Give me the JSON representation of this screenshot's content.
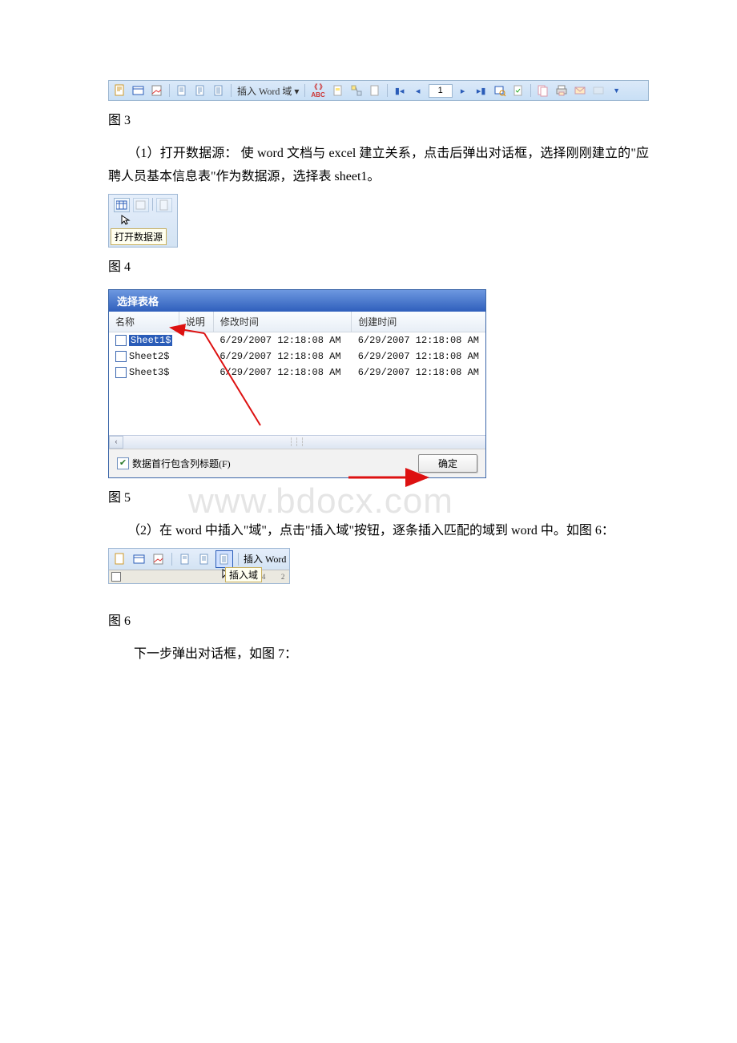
{
  "fig3": {
    "caption": "图 3",
    "insert_word_field": "插入 Word 域 ▾",
    "record_num": "1"
  },
  "paragraph1": "　　（1）打开数据源： 使 word 文档与 excel 建立关系，点击后弹出对话框，选择刚刚建立的\"应聘人员基本信息表\"作为数据源，选择表 sheet1。",
  "fig4": {
    "tooltip": "打开数据源",
    "caption": "图 4"
  },
  "fig5": {
    "title": "选择表格",
    "columns": {
      "name": "名称",
      "desc": "说明",
      "modified": "修改时间",
      "created": "创建时间"
    },
    "rows": [
      {
        "name": "Sheet1$",
        "modified": "6/29/2007 12:18:08 AM",
        "created": "6/29/2007 12:18:08 AM"
      },
      {
        "name": "Sheet2$",
        "modified": "6/29/2007 12:18:08 AM",
        "created": "6/29/2007 12:18:08 AM"
      },
      {
        "name": "Sheet3$",
        "modified": "6/29/2007 12:18:08 AM",
        "created": "6/29/2007 12:18:08 AM"
      }
    ],
    "checkbox": "数据首行包含列标题(F)",
    "ok": "确定",
    "caption": "图 5"
  },
  "watermark": "www.bdocx.com",
  "paragraph2": "　　（2）在 word 中插入\"域\"，点击\"插入域\"按钮，逐条插入匹配的域到 word 中。如图 6：",
  "fig6": {
    "insert_word": "插入 Word",
    "tooltip": "插入域",
    "ruler_marks": [
      "4",
      "2"
    ],
    "caption": "图 6"
  },
  "paragraph3": "　　下一步弹出对话框，如图 7："
}
